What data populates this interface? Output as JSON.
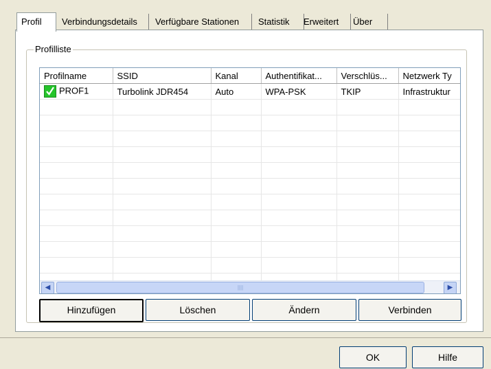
{
  "tabs": [
    {
      "label": "Profil"
    },
    {
      "label": "Verbindungsdetails"
    },
    {
      "label": "Verfügbare Stationen"
    },
    {
      "label": "Statistik"
    },
    {
      "label": "Erweitert"
    },
    {
      "label": "Über"
    }
  ],
  "group": {
    "title": "Profilliste"
  },
  "table": {
    "columns": [
      "Profilname",
      "SSID",
      "Kanal",
      "Authentifikat...",
      "Verschlüs...",
      "Netzwerk Ty"
    ],
    "rows": [
      {
        "name": "PROF1",
        "ssid": "Turbolink JDR454",
        "channel": "Auto",
        "auth": "WPA-PSK",
        "enc": "TKIP",
        "net": "Infrastruktur"
      }
    ],
    "active_icon": "check-icon",
    "active_icon_color": "#24c42a"
  },
  "buttons": {
    "add": "Hinzufügen",
    "delete": "Löschen",
    "edit": "Ändern",
    "connect": "Verbinden"
  },
  "dialog": {
    "ok": "OK",
    "help": "Hilfe"
  }
}
